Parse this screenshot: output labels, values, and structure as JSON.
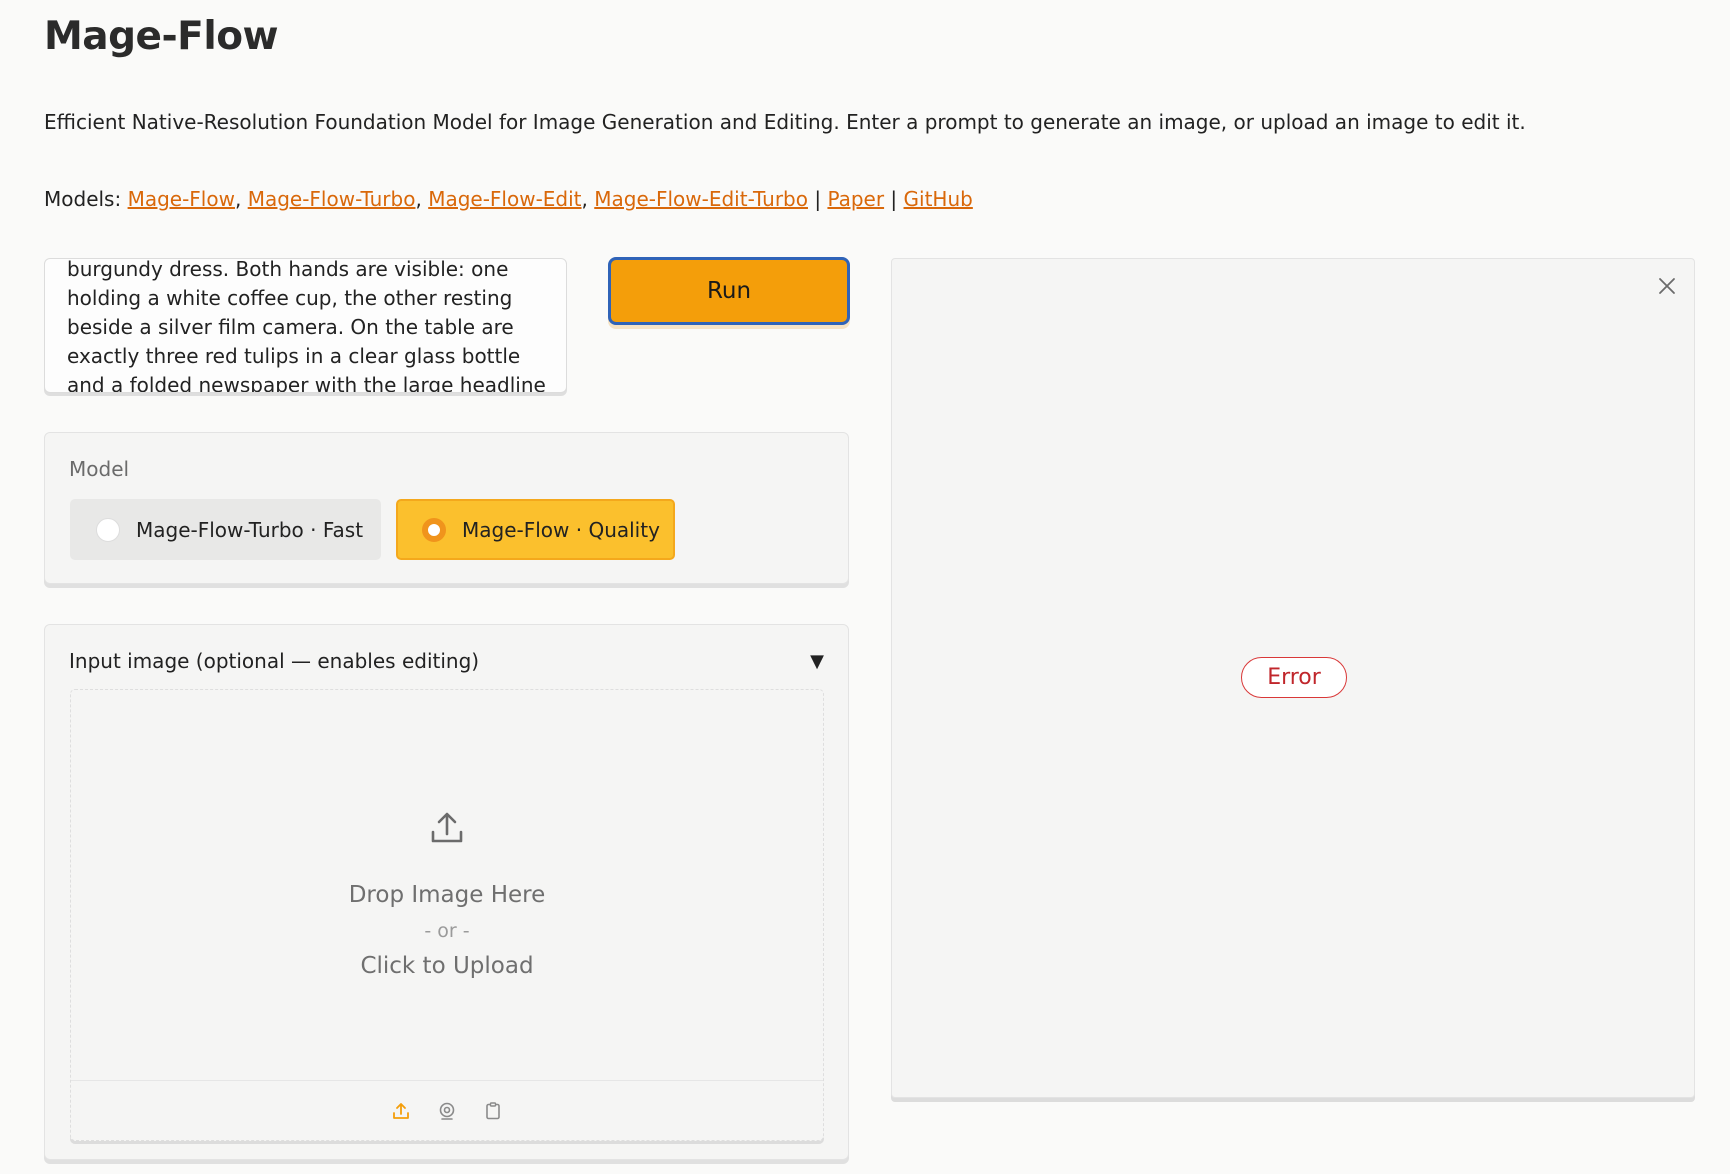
{
  "header": {
    "title": "Mage-Flow",
    "description": "Efficient Native-Resolution Foundation Model for Image Generation and Editing. Enter a prompt to generate an image, or upload an image to edit it.",
    "models_prefix": "Models: ",
    "links": {
      "mage_flow": "Mage-Flow",
      "mage_flow_turbo": "Mage-Flow-Turbo",
      "mage_flow_edit": "Mage-Flow-Edit",
      "mage_flow_edit_turbo": "Mage-Flow-Edit-Turbo",
      "paper": "Paper",
      "github": "GitHub"
    },
    "sep_comma": ", ",
    "sep_pipe": " | "
  },
  "prompt": {
    "visible_text": "burgundy dress. Both hands are visible: one holding a white coffee cup, the other resting beside a silver film camera. On the table are exactly three red tulips in a clear glass bottle and a folded newspaper with the large headline"
  },
  "run_button": {
    "label": "Run"
  },
  "model_selector": {
    "label": "Model",
    "options": [
      {
        "label": "Mage-Flow-Turbo · Fast",
        "selected": false
      },
      {
        "label": "Mage-Flow · Quality",
        "selected": true
      }
    ]
  },
  "input_image": {
    "title": "Input image (optional — enables editing)",
    "collapse_glyph": "▼",
    "drop_text": "Drop Image Here",
    "or_text": "- or -",
    "click_text": "Click to Upload"
  },
  "output": {
    "status": "Error"
  },
  "colors": {
    "accent": "#f49e0a",
    "selected_option": "#fbc02d",
    "link": "#d9680a",
    "error": "#c0262b"
  }
}
